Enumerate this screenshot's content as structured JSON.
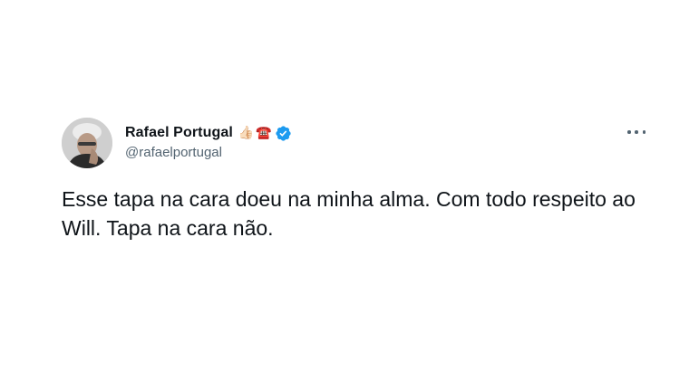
{
  "author": {
    "display_name": "Rafael Portugal",
    "name_emojis": [
      "👍🏻",
      "☎️"
    ],
    "handle": "@rafaelportugal",
    "verified": true,
    "verified_color": "#1d9bf0"
  },
  "tweet": {
    "text": "Esse tapa na cara doeu na minha alma. Com todo respeito ao Will. Tapa na cara não."
  },
  "icons": {
    "more": "more-options-icon",
    "verified": "verified-badge-icon"
  }
}
